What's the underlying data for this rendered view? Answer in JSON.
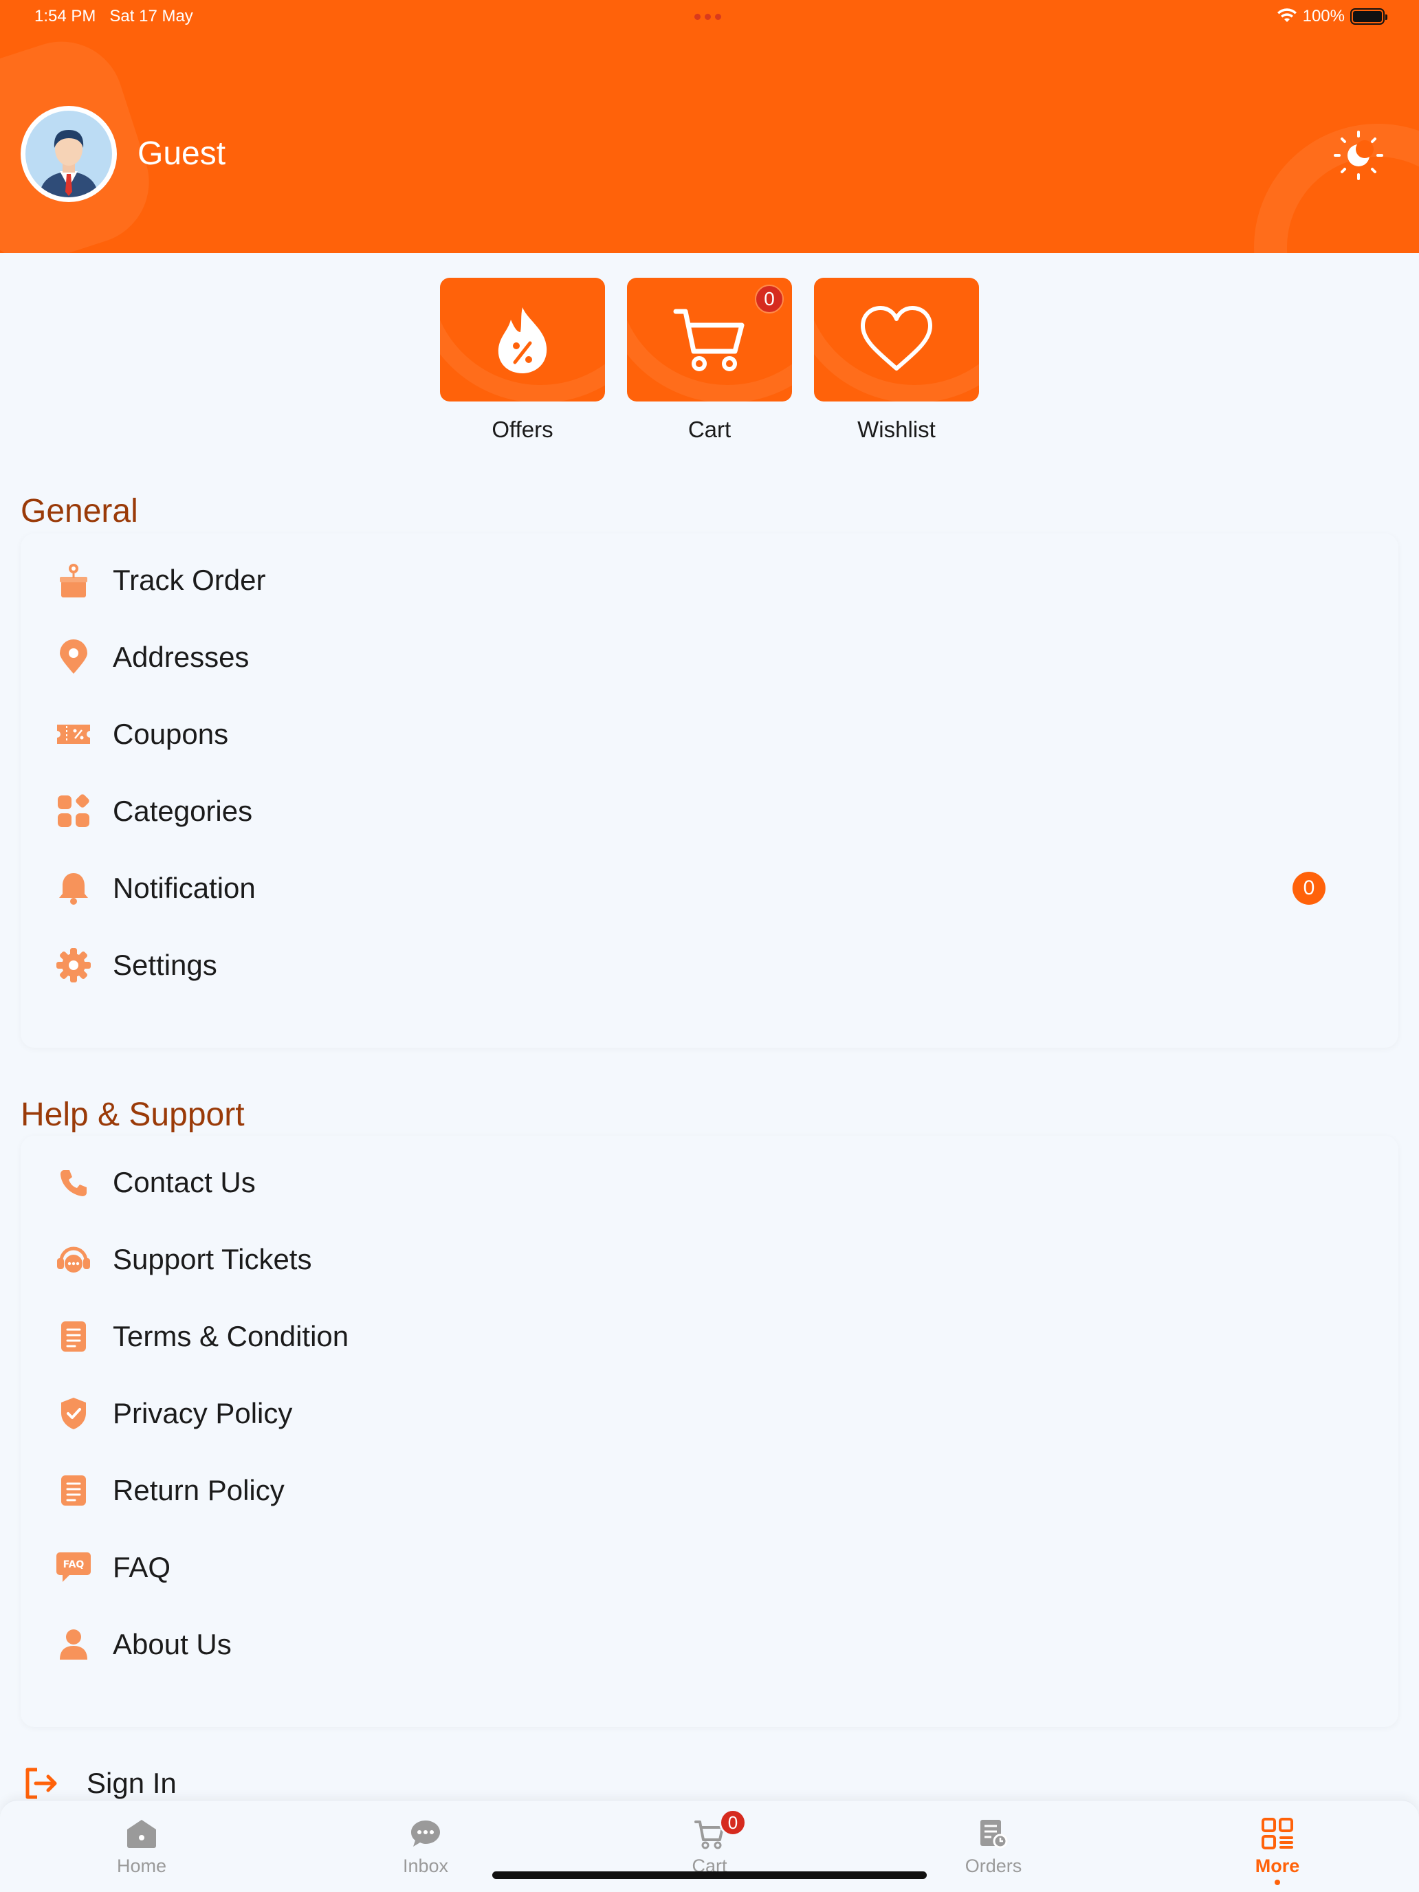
{
  "status_bar": {
    "time": "1:54 PM",
    "date": "Sat 17 May",
    "battery": "100%"
  },
  "header": {
    "user_name": "Guest"
  },
  "quick_actions": [
    {
      "label": "Offers"
    },
    {
      "label": "Cart",
      "badge": "0"
    },
    {
      "label": "Wishlist"
    }
  ],
  "general": {
    "title": "General",
    "items": [
      {
        "label": "Track Order",
        "icon": "track-order-icon"
      },
      {
        "label": "Addresses",
        "icon": "location-pin-icon"
      },
      {
        "label": "Coupons",
        "icon": "coupon-icon"
      },
      {
        "label": "Categories",
        "icon": "categories-icon"
      },
      {
        "label": "Notification",
        "icon": "bell-icon",
        "badge": "0"
      },
      {
        "label": "Settings",
        "icon": "gear-icon"
      }
    ]
  },
  "support": {
    "title": "Help & Support",
    "items": [
      {
        "label": "Contact Us",
        "icon": "phone-icon"
      },
      {
        "label": "Support Tickets",
        "icon": "headset-icon"
      },
      {
        "label": "Terms & Condition",
        "icon": "document-icon"
      },
      {
        "label": "Privacy Policy",
        "icon": "shield-check-icon"
      },
      {
        "label": "Return Policy",
        "icon": "document-icon"
      },
      {
        "label": "FAQ",
        "icon": "faq-icon"
      },
      {
        "label": "About Us",
        "icon": "person-icon"
      }
    ]
  },
  "sign_in": {
    "label": "Sign In"
  },
  "bottom_nav": {
    "items": [
      {
        "label": "Home",
        "icon": "home-icon"
      },
      {
        "label": "Inbox",
        "icon": "chat-icon"
      },
      {
        "label": "Cart",
        "icon": "cart-icon",
        "badge": "0"
      },
      {
        "label": "Orders",
        "icon": "orders-icon"
      },
      {
        "label": "More",
        "icon": "grid-icon",
        "active": true
      }
    ]
  },
  "colors": {
    "primary": "#ff620a",
    "section_title": "#9a3a08",
    "badge_red": "#d62b1f",
    "icon_light": "#f7935a"
  }
}
